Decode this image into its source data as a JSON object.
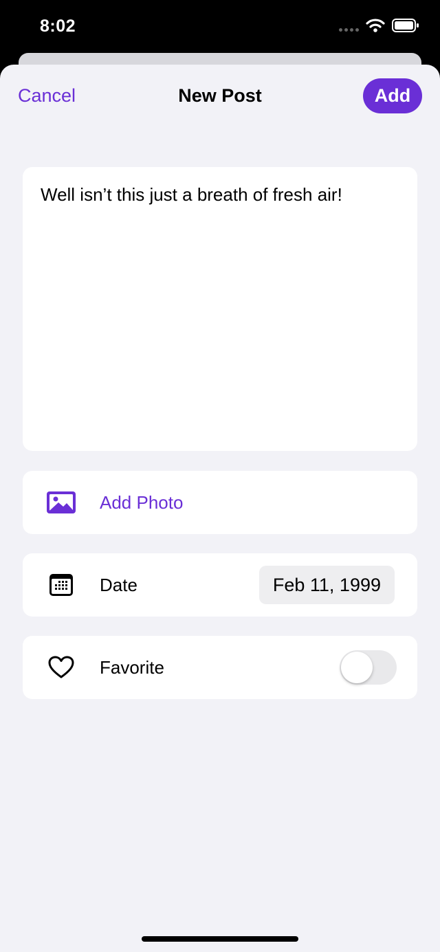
{
  "status": {
    "time": "8:02"
  },
  "nav": {
    "cancel": "Cancel",
    "title": "New Post",
    "add": "Add"
  },
  "post": {
    "text": "Well isn’t this just a breath of fresh air!"
  },
  "photo_row": {
    "label": "Add Photo",
    "icon": "photo-icon"
  },
  "date_row": {
    "label": "Date",
    "value": "Feb 11, 1999",
    "icon": "calendar-icon"
  },
  "favorite_row": {
    "label": "Favorite",
    "icon": "heart-icon",
    "on": false
  },
  "colors": {
    "accent": "#6a2fd6",
    "background": "#f2f2f7",
    "card": "#ffffff"
  }
}
